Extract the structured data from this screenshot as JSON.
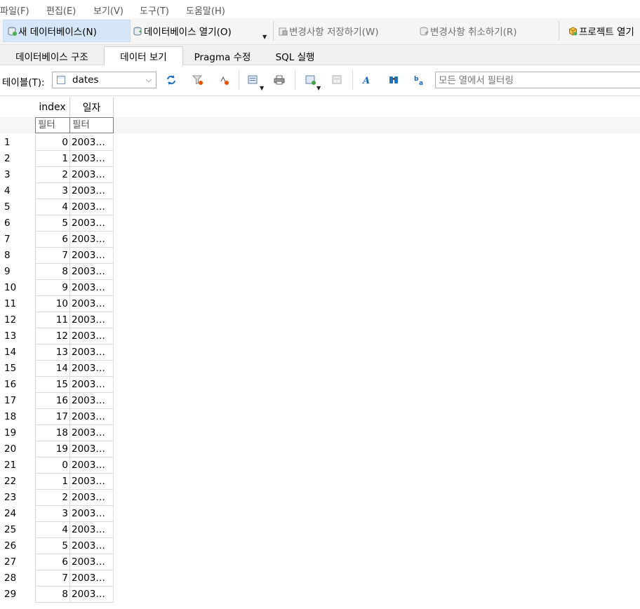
{
  "menu": [
    "파일(F)",
    "편집(E)",
    "보기(V)",
    "도구(T)",
    "도움말(H)"
  ],
  "toolbar": {
    "new_db": "새 데이터베이스(N)",
    "open_db": "데이터베이스 열기(O)",
    "write_changes": "변경사항 저장하기(W)",
    "revert_changes": "변경사항 취소하기(R)",
    "project": "프로젝트 열기"
  },
  "tabs": [
    "데이터베이스 구조",
    "데이터 보기",
    "Pragma 수정",
    "SQL 실행"
  ],
  "selected_tab": "데이터 보기",
  "table_toolbar": {
    "table_label": "테이블(T):",
    "table_name": "dates",
    "filter_placeholder": "모든 열에서 필터링"
  },
  "grid": {
    "columns": [
      "index",
      "일자"
    ],
    "filter_placeholders": [
      "필터",
      "필터"
    ],
    "rows": [
      {
        "n": "1",
        "index": "0",
        "date": "2003…"
      },
      {
        "n": "2",
        "index": "1",
        "date": "2003…"
      },
      {
        "n": "3",
        "index": "2",
        "date": "2003…"
      },
      {
        "n": "4",
        "index": "3",
        "date": "2003…"
      },
      {
        "n": "5",
        "index": "4",
        "date": "2003…"
      },
      {
        "n": "6",
        "index": "5",
        "date": "2003…"
      },
      {
        "n": "7",
        "index": "6",
        "date": "2003…"
      },
      {
        "n": "8",
        "index": "7",
        "date": "2003…"
      },
      {
        "n": "9",
        "index": "8",
        "date": "2003…"
      },
      {
        "n": "10",
        "index": "9",
        "date": "2003…"
      },
      {
        "n": "11",
        "index": "10",
        "date": "2003…"
      },
      {
        "n": "12",
        "index": "11",
        "date": "2003…"
      },
      {
        "n": "13",
        "index": "12",
        "date": "2003…"
      },
      {
        "n": "14",
        "index": "13",
        "date": "2003…"
      },
      {
        "n": "15",
        "index": "14",
        "date": "2003…"
      },
      {
        "n": "16",
        "index": "15",
        "date": "2003…"
      },
      {
        "n": "17",
        "index": "16",
        "date": "2003…"
      },
      {
        "n": "18",
        "index": "17",
        "date": "2003…"
      },
      {
        "n": "19",
        "index": "18",
        "date": "2003…"
      },
      {
        "n": "20",
        "index": "19",
        "date": "2003…"
      },
      {
        "n": "21",
        "index": "0",
        "date": "2003…"
      },
      {
        "n": "22",
        "index": "1",
        "date": "2003…"
      },
      {
        "n": "23",
        "index": "2",
        "date": "2003…"
      },
      {
        "n": "24",
        "index": "3",
        "date": "2003…"
      },
      {
        "n": "25",
        "index": "4",
        "date": "2003…"
      },
      {
        "n": "26",
        "index": "5",
        "date": "2003…"
      },
      {
        "n": "27",
        "index": "6",
        "date": "2003…"
      },
      {
        "n": "28",
        "index": "7",
        "date": "2003…"
      },
      {
        "n": "29",
        "index": "8",
        "date": "2003…"
      }
    ]
  },
  "colors": {
    "selected_button": "#d4e6f7",
    "grid_line": "#d9d9d9"
  }
}
